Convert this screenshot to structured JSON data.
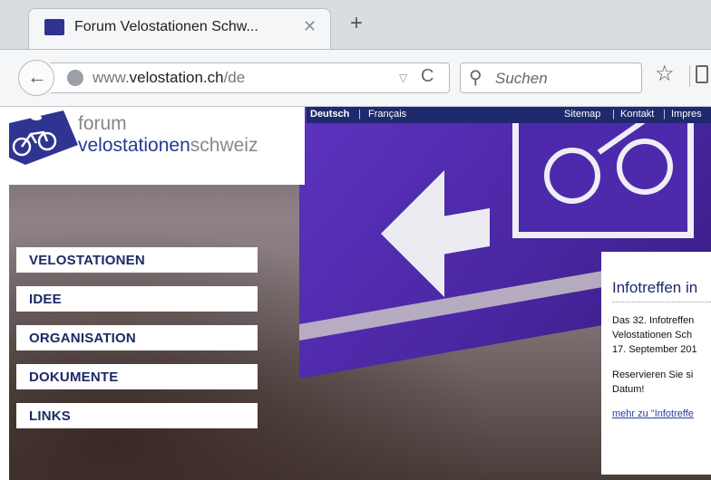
{
  "browser": {
    "tab_title": "Forum Velostationen Schw...",
    "tab_close": "✕",
    "new_tab": "+",
    "back": "←",
    "url_prefix": "www.",
    "url_domain": "velostation.ch",
    "url_path": "/de",
    "reload": "C",
    "search_placeholder": "Suchen",
    "star": "☆"
  },
  "langbar": {
    "german": "Deutsch",
    "sep": "|",
    "french": "Français",
    "sitemap": "Sitemap",
    "kontakt": "Kontakt",
    "impressum": "Impres"
  },
  "logo": {
    "line1": "forum",
    "line2_strong": "velostationen",
    "line2_rest": "schweiz"
  },
  "menu": {
    "items": [
      {
        "label": "VELOSTATIONEN"
      },
      {
        "label": "IDEE"
      },
      {
        "label": "ORGANISATION"
      },
      {
        "label": "DOKUMENTE"
      },
      {
        "label": "LINKS"
      }
    ]
  },
  "info": {
    "title": "Infotreffen in",
    "p1_line1": "Das 32. Infotreffen",
    "p1_line2": "Velostationen Sch",
    "p1_line3": "17. September 201",
    "p2_line1": "Reservieren Sie si",
    "p2_line2": "Datum!",
    "link": "mehr zu \"Infotreffe"
  }
}
